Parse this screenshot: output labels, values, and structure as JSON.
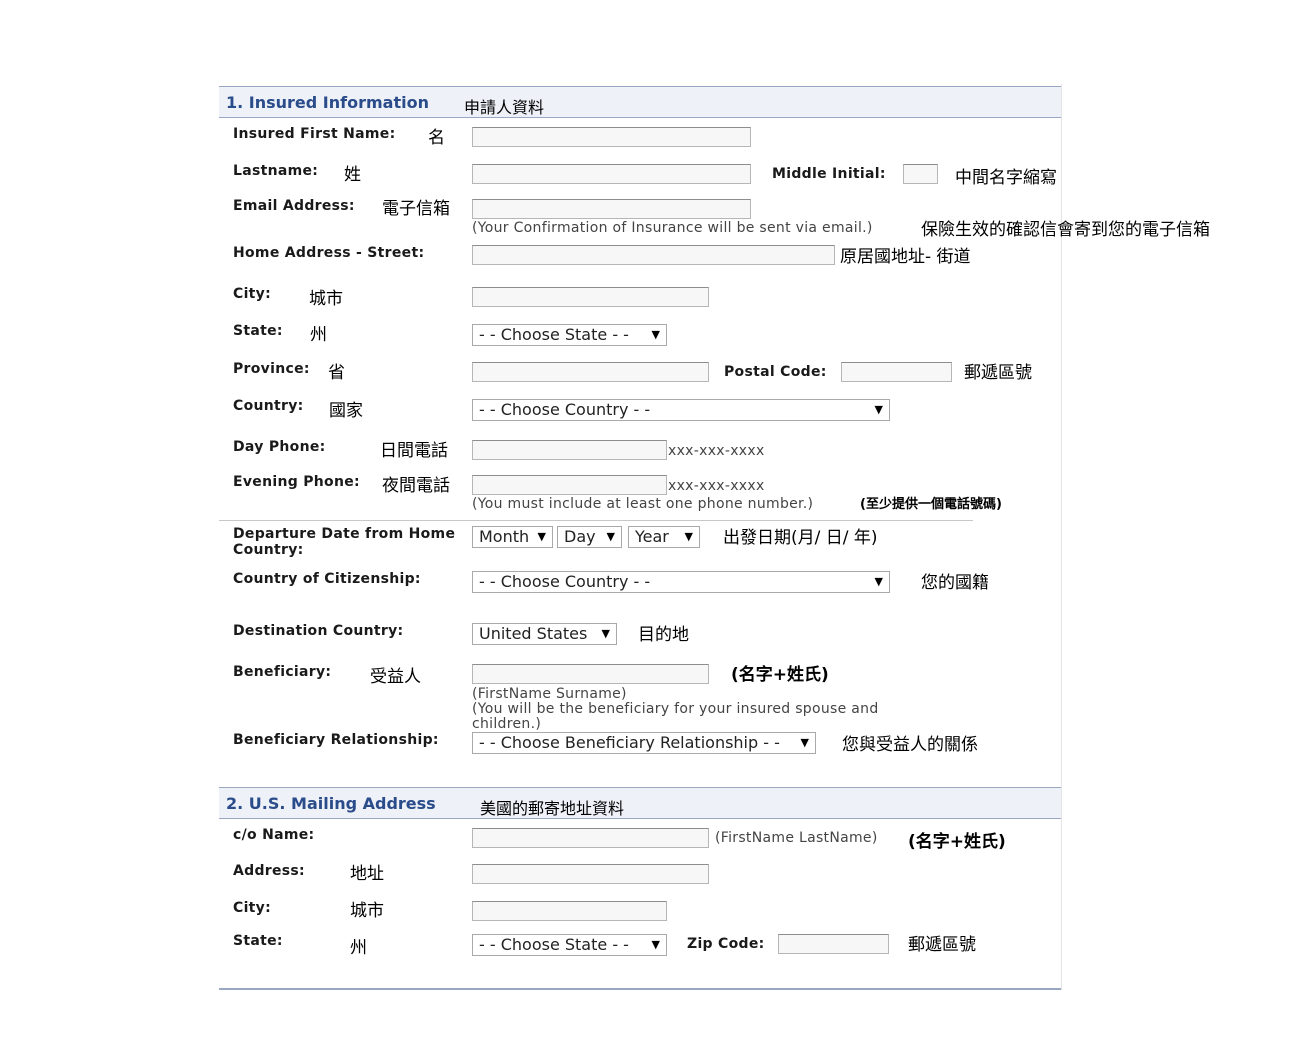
{
  "section1": {
    "title": "1. Insured Information",
    "title_zh": "申請人資料",
    "first_name": {
      "label": "Insured First Name:",
      "zh": "名",
      "value": ""
    },
    "last_name": {
      "label": "Lastname:",
      "zh": "姓",
      "value": ""
    },
    "middle_initial": {
      "label": "Middle Initial:",
      "zh": "中間名字縮寫",
      "value": ""
    },
    "email": {
      "label": "Email Address:",
      "zh": "電子信箱",
      "value": "",
      "hint": "(Your Confirmation of Insurance will be sent via email.)",
      "hint_zh": "保險生效的確認信會寄到您的電子信箱"
    },
    "street": {
      "label": "Home Address - Street:",
      "zh": "原居國地址- 街道",
      "value": ""
    },
    "city": {
      "label": "City:",
      "zh": "城市",
      "value": ""
    },
    "state": {
      "label": "State:",
      "zh": "州",
      "selected": "- - Choose State - -"
    },
    "province": {
      "label": "Province:",
      "zh": "省",
      "value": ""
    },
    "postal_code": {
      "label": "Postal Code:",
      "zh": "郵遞區號",
      "value": ""
    },
    "country": {
      "label": "Country:",
      "zh": "國家",
      "selected": "- - Choose Country - -"
    },
    "day_phone": {
      "label": "Day Phone:",
      "zh": "日間電話",
      "value": "",
      "format": "xxx-xxx-xxxx"
    },
    "evening_phone": {
      "label": "Evening Phone:",
      "zh": "夜間電話",
      "value": "",
      "format": "xxx-xxx-xxxx",
      "hint": "(You must include at least one phone number.)",
      "hint_zh": "(至少提供一個電話號碼)"
    },
    "departure": {
      "label_line1": "Departure Date from Home",
      "label_line2": "Country:",
      "month": "Month",
      "day": "Day",
      "year": "Year",
      "zh": "出發日期(月/ 日/ 年)"
    },
    "citizenship": {
      "label": "Country of Citizenship:",
      "selected": "- - Choose Country - -",
      "zh": "您的國籍"
    },
    "destination": {
      "label": "Destination Country:",
      "selected": "United States",
      "zh": "目的地"
    },
    "beneficiary": {
      "label": "Beneficiary:",
      "zh": "受益人",
      "value": "",
      "zh_note": "(名字+姓氏)",
      "hint1": "(FirstName Surname)",
      "hint2": "(You will be the beneficiary for your insured spouse and",
      "hint3": "children.)"
    },
    "relationship": {
      "label": "Beneficiary Relationship:",
      "selected": "- - Choose Beneficiary Relationship - -",
      "zh": "您與受益人的關係"
    }
  },
  "section2": {
    "title": "2. U.S. Mailing Address",
    "title_zh": "美國的郵寄地址資料",
    "co_name": {
      "label": "c/o Name:",
      "value": "",
      "hint": "(FirstName LastName)",
      "zh": "(名字+姓氏)"
    },
    "address": {
      "label": "Address:",
      "zh": "地址",
      "value": ""
    },
    "city": {
      "label": "City:",
      "zh": "城市",
      "value": ""
    },
    "state": {
      "label": "State:",
      "zh": "州",
      "selected": "- - Choose State - -"
    },
    "zip": {
      "label": "Zip Code:",
      "zh": "郵遞區號",
      "value": ""
    }
  },
  "dropdown_arrow": "▼",
  "colors": {
    "section_title": "#2a4c8a",
    "section_bg": "#eef1f8",
    "section_border": "#9aa7c2"
  }
}
